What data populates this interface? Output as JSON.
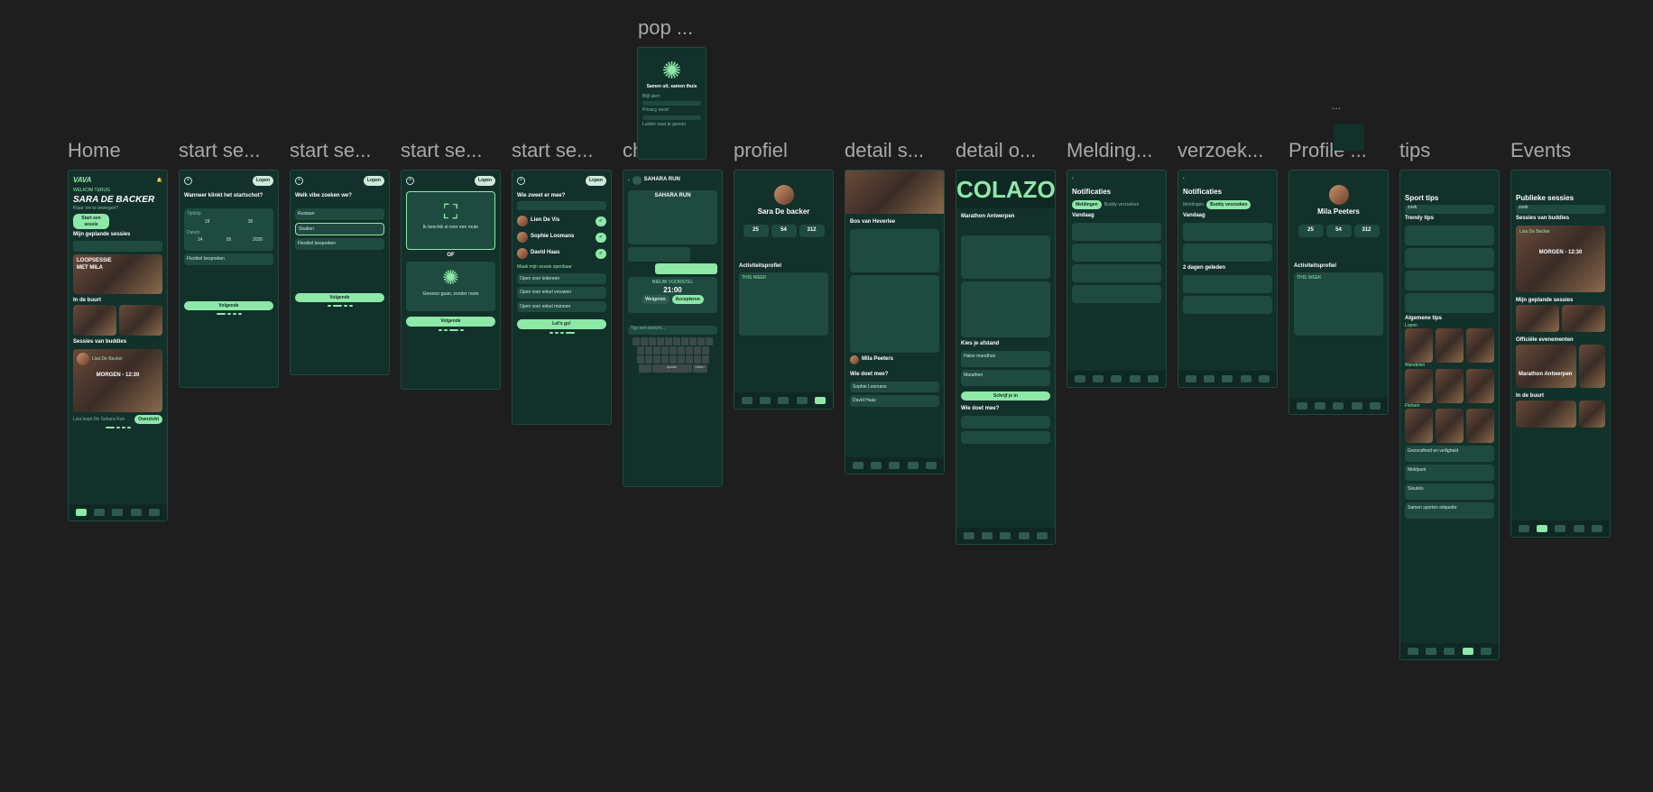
{
  "frames": [
    {
      "label": "Home"
    },
    {
      "label": "start se..."
    },
    {
      "label": "start se..."
    },
    {
      "label": "start se..."
    },
    {
      "label": "start se..."
    },
    {
      "label": "chat"
    },
    {
      "label": "profiel"
    },
    {
      "label": "detail s..."
    },
    {
      "label": "detail o..."
    },
    {
      "label": "Melding..."
    },
    {
      "label": "verzoek..."
    },
    {
      "label": "Profile ..."
    },
    {
      "label": "tips"
    },
    {
      "label": "Events"
    }
  ],
  "popup": {
    "label": "pop ...",
    "title": "Samen uit, samen thuis",
    "items": [
      "Blijf alert",
      "Privacy eerst",
      "Luister naar je gevoel"
    ]
  },
  "dots_label": "...",
  "home": {
    "brand": "VAVA",
    "welcome": "WELKOM TERUG",
    "name": "SARA DE BACKER",
    "sub": "Klaar om te bewegen?",
    "cta": "Start een sessie",
    "planned": "Mijn geplande sessies",
    "session_title": "LOOPSESSIE MET MILA",
    "nearby": "In de buurt",
    "buddies": "Sessies van buddies",
    "buddy_name": "Lisa De Backer",
    "buddy_when": "MORGEN - 12:30",
    "buddy_detail": "Lisa loopt De Sahara Run",
    "overview": "Overzicht"
  },
  "start1": {
    "top": "Lopen",
    "q": "Wanneer klinkt het startschot?",
    "time": "Tijdstip",
    "h": "19",
    "m": "30",
    "date": "Datum",
    "d": "14",
    "mo": "05",
    "y": "2026",
    "flex": "Flexibel bespreken",
    "next": "Volgende"
  },
  "start2": {
    "top": "Lopen",
    "q": "Welk vibe zoeken we?",
    "opts": [
      "Rustaan",
      "Studien",
      "Flexibel bespreken"
    ],
    "next": "Volgende"
  },
  "start3": {
    "top": "Lopen",
    "map_text": "Ik beschik al over een route",
    "or": "OF",
    "rnd": "Gewoon gaan, zonder route",
    "next": "Volgende"
  },
  "start4": {
    "top": "Lopen",
    "q": "Wie zweet er mee?",
    "buddies": [
      "Lien De Vis",
      "Sophie Loomans",
      "David Haas"
    ],
    "extra": "Maak mijn sessie openbaar",
    "opts": [
      "Open voor iedereen",
      "Open voor enkel vrouwen",
      "Open voor enkel mannen"
    ],
    "cta": "Let's go!"
  },
  "chat": {
    "who": "SAHARA RUN",
    "card_title": "SAHARA RUN",
    "time": "21:00",
    "input": "Typ een bericht...",
    "proposal": "NIEUW VOORSTEL",
    "accept": "Accepteren",
    "decline": "Weigeren",
    "space": "spatie",
    "ret": "return"
  },
  "profiel": {
    "name": "Sara De backer",
    "s1": "25",
    "s2": "54",
    "s3": "312",
    "act": "Activiteitsprofiel",
    "week": "THIS WEEK"
  },
  "detail_s": {
    "title": "Bos van Heverlee",
    "who": "Wie doet mee?",
    "names": [
      "Sophie Loomans",
      "David Haas"
    ],
    "org": "Mila Peeters"
  },
  "detail_o": {
    "brand": "COLAZO",
    "title": "Marathon Antwerpen",
    "dist": "Kies je afstand",
    "d1": "Halve marathon",
    "d2": "Marathon",
    "cta": "Schrijf je in",
    "who": "Wie doet mee?"
  },
  "melding": {
    "title": "Notificaties",
    "tab1": "Meldingen",
    "tab2": "Buddy verzoeken",
    "today": "Vandaag"
  },
  "verzoek": {
    "title": "Notificaties",
    "tab1": "Meldingen",
    "tab2": "Buddy verzoeken",
    "today": "Vandaag",
    "ago": "2 dagen geleden"
  },
  "profile2": {
    "name": "Mila Peeters",
    "s1": "25",
    "s2": "54",
    "s3": "312",
    "act": "Activiteitsprofiel",
    "week": "THIS WEEK"
  },
  "tips": {
    "title": "Sport tips",
    "search": "zoek",
    "trendy": "Trendy tips",
    "general": "Algemene tips",
    "cats": [
      "Lopen",
      "Wandelen",
      "Fietsen"
    ],
    "items": [
      "Gezondheid en veiligheid",
      "Meldpunt",
      "Sleutels",
      "Samen sporten etiquette"
    ]
  },
  "events": {
    "title": "Publieke sessies",
    "search": "zoek",
    "buddies": "Sessies van buddies",
    "name": "Lisa De Backer",
    "when": "MORGEN - 12:30",
    "planned": "Mijn geplande sessies",
    "official": "Officiële evenementen",
    "ev": "Marathon Antwerpen",
    "nearby": "In de buurt"
  }
}
